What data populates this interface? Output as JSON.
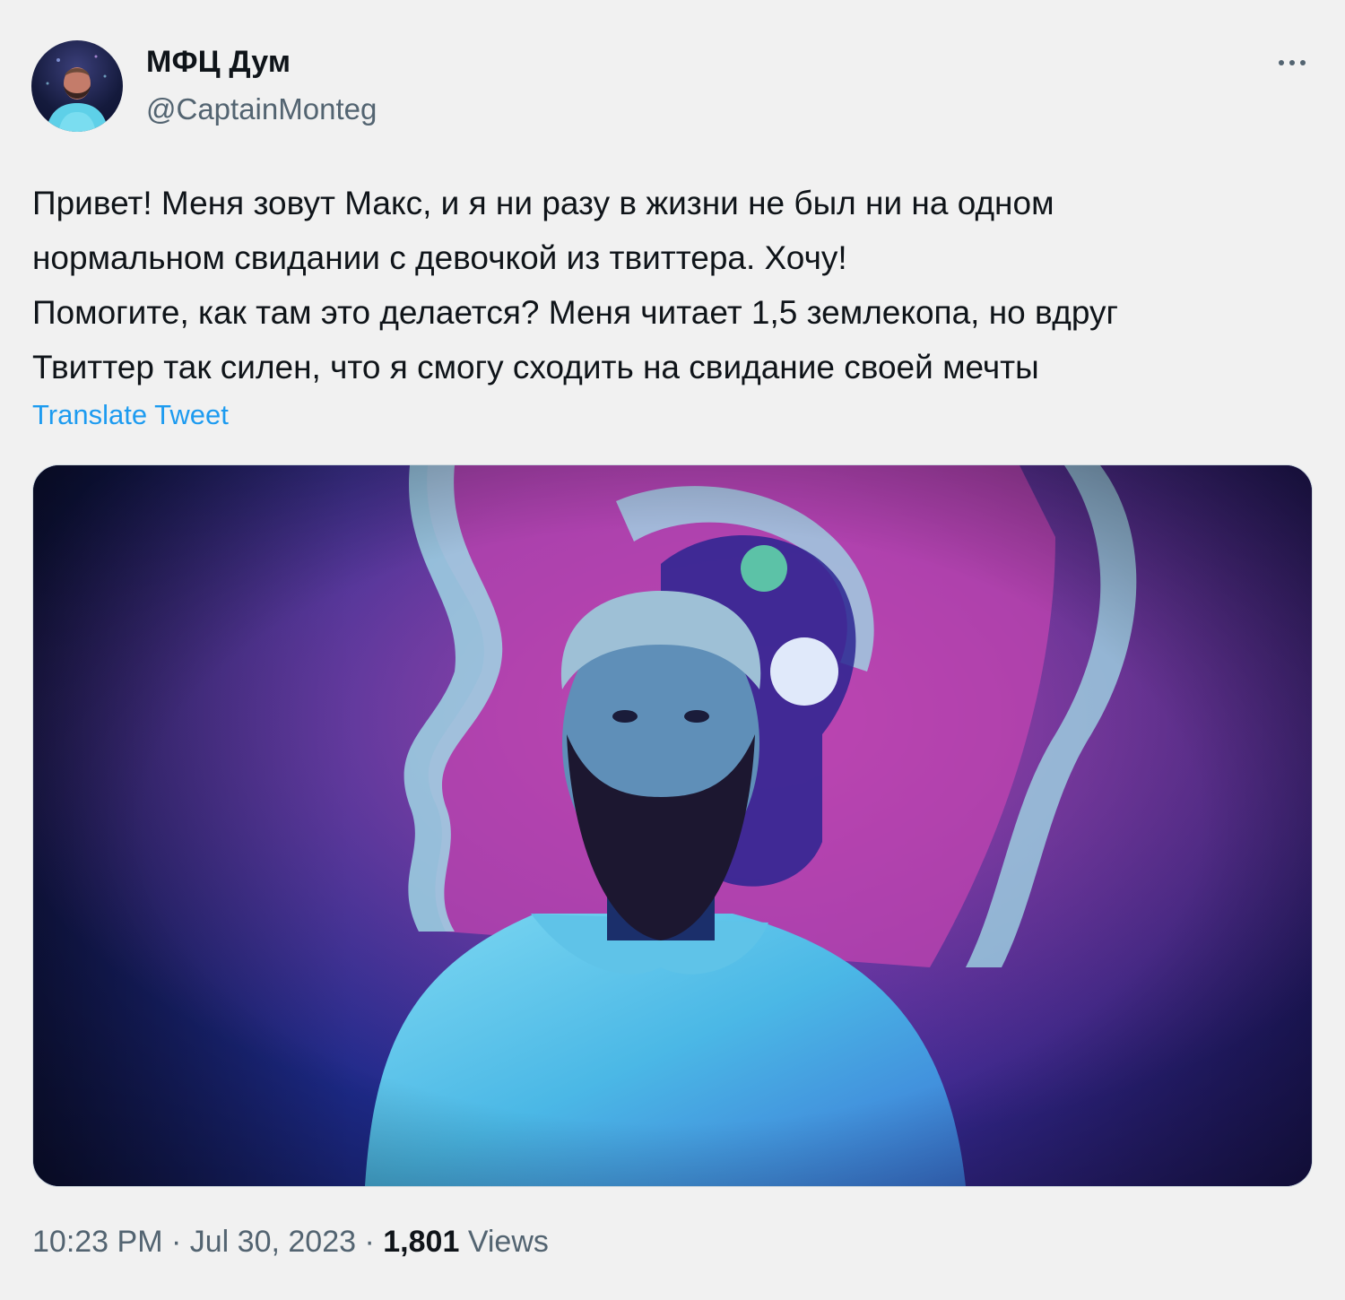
{
  "author": {
    "display_name": "МФЦ Дум",
    "handle": "@CaptainMonteg"
  },
  "tweet": {
    "lines": [
      "Привет! Меня зовут Макс, и я ни разу в жизни не был ни на одном",
      "нормальном свидании с девочкой из твиттера. Хочу!",
      "Помогите, как там это делается? Меня читает 1,5 землекопа, но вдруг",
      "Твиттер так силен, что я смогу сходить на свидание своей мечты"
    ],
    "translate_label": "Translate Tweet"
  },
  "meta": {
    "time": "10:23 PM",
    "separator": "·",
    "date": "Jul 30, 2023",
    "views_count": "1,801",
    "views_label": "Views"
  },
  "icons": {
    "more": "more-horizontal-icon"
  },
  "colors": {
    "background": "#f1f1f1",
    "link": "#1d9bf0",
    "secondary_text": "#536471",
    "primary_text": "#0f1419"
  }
}
